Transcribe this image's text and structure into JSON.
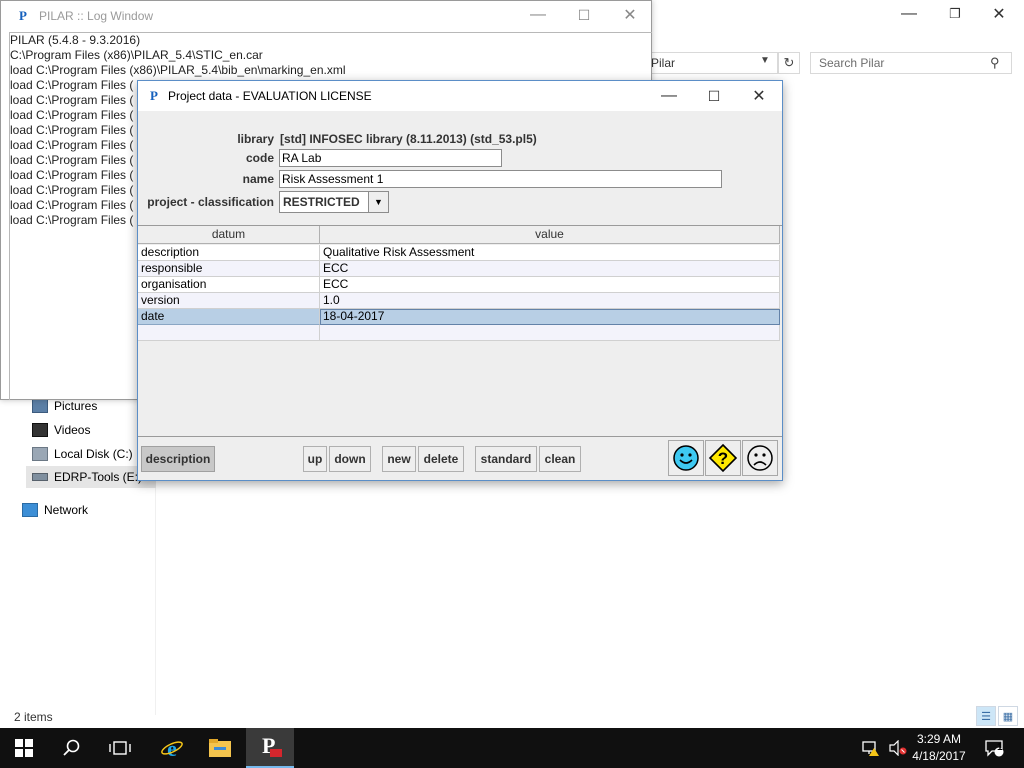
{
  "explorer": {
    "address_text": "Pilar",
    "search_placeholder": "Search Pilar",
    "nav_items": [
      {
        "label": "Pictures",
        "icon": "pictures-folder-icon"
      },
      {
        "label": "Videos",
        "icon": "videos-folder-icon"
      },
      {
        "label": "Local Disk (C:)",
        "icon": "local-disk-icon"
      },
      {
        "label": "EDRP-Tools (E:)",
        "icon": "network-drive-icon"
      },
      {
        "label": "Network",
        "icon": "network-icon"
      }
    ],
    "status": "2 items"
  },
  "log_window": {
    "title": "PILAR :: Log Window",
    "lines": [
      "PILAR (5.4.8 - 9.3.2016)",
      "C:\\Program Files (x86)\\PILAR_5.4\\STIC_en.car",
      "load C:\\Program Files (x86)\\PILAR_5.4\\bib_en\\marking_en.xml",
      "load C:\\Program Files (",
      "load C:\\Program Files (",
      "load C:\\Program Files (",
      "load C:\\Program Files (",
      "load C:\\Program Files (",
      "load C:\\Program Files (",
      "load C:\\Program Files (",
      "load C:\\Program Files (",
      "load C:\\Program Files (",
      "load C:\\Program Files ("
    ]
  },
  "dialog": {
    "title": "Project data - EVALUATION LICENSE",
    "library_label": "library",
    "library_value": "[std] INFOSEC library (8.11.2013) (std_53.pl5)",
    "code_label": "code",
    "code_value": "RA Lab",
    "name_label": "name",
    "name_value": "Risk Assessment 1",
    "classification_label": "project - classification",
    "classification_value": "RESTRICTED",
    "table": {
      "headers": [
        "datum",
        "value"
      ],
      "rows": [
        {
          "datum": "description",
          "value": "Qualitative Risk Assessment"
        },
        {
          "datum": "responsible",
          "value": "ECC"
        },
        {
          "datum": "organisation",
          "value": "ECC"
        },
        {
          "datum": "version",
          "value": "1.0"
        },
        {
          "datum": "date",
          "value": "18-04-2017"
        },
        {
          "datum": "",
          "value": ""
        }
      ]
    },
    "buttons": {
      "description": "description",
      "up": "up",
      "down": "down",
      "new": "new",
      "delete": "delete",
      "standard": "standard",
      "clean": "clean"
    }
  },
  "taskbar": {
    "time": "3:29 AM",
    "date": "4/18/2017",
    "notification_count": "1"
  }
}
